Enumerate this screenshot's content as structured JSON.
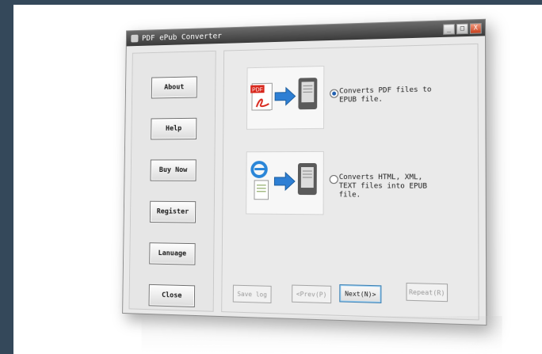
{
  "window": {
    "title": "PDF ePub Converter",
    "controls": [
      "_",
      "□",
      "X"
    ]
  },
  "sidebar": {
    "buttons": [
      "About",
      "Help",
      "Buy Now",
      "Register",
      "Lanuage",
      "Close"
    ]
  },
  "main": {
    "options": [
      {
        "label": "Converts PDF files to EPUB file.",
        "selected": true,
        "icons": [
          "pdf-file-icon",
          "arrow-right-icon",
          "ebook-reader-icon"
        ]
      },
      {
        "label": "Converts HTML, XML, TEXT files into EPUB file.",
        "selected": false,
        "icons": [
          "internet-explorer-icon",
          "text-document-icon",
          "arrow-right-icon",
          "ebook-reader-icon"
        ]
      }
    ],
    "buttons": {
      "save_log": "Save log",
      "prev": "<Prev(P)",
      "next": "Next(N)>",
      "repeat": "Repeat(R)"
    }
  },
  "colors": {
    "accent": "#3c7fb1",
    "pdf_red": "#d8281d",
    "arrow_blue": "#2e7fd4"
  }
}
